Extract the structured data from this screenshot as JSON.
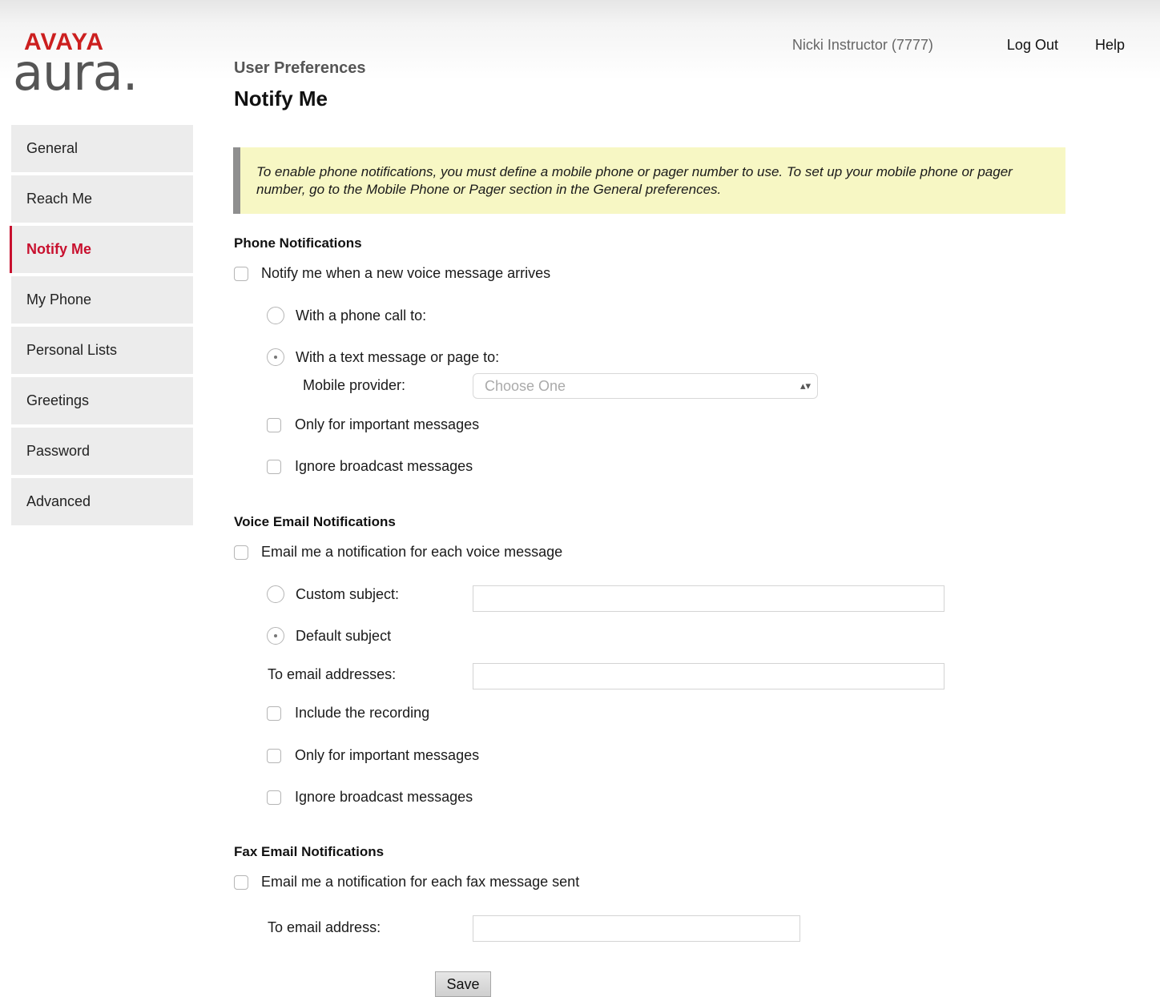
{
  "header": {
    "brand": "AVAYA",
    "product": "aura.",
    "user": "Nicki Instructor (7777)",
    "logout": "Log Out",
    "help": "Help"
  },
  "breadcrumb": "User Preferences",
  "page_title": "Notify Me",
  "sidebar": {
    "items": [
      {
        "label": "General"
      },
      {
        "label": "Reach Me"
      },
      {
        "label": "Notify Me",
        "active": true
      },
      {
        "label": "My Phone"
      },
      {
        "label": "Personal Lists"
      },
      {
        "label": "Greetings"
      },
      {
        "label": "Password"
      },
      {
        "label": "Advanced"
      }
    ]
  },
  "notice": "To enable phone notifications, you must define a mobile phone or pager number to use. To set up your mobile phone or pager number, go to the Mobile Phone or Pager section in the General preferences.",
  "phone": {
    "title": "Phone Notifications",
    "notify": {
      "label": "Notify me when a new voice message arrives",
      "checked": false
    },
    "phone_call": {
      "label": "With a phone call to:",
      "selected": false
    },
    "text_message": {
      "label": "With a text message or page to:",
      "selected": true
    },
    "mobile_provider": {
      "label": "Mobile provider:",
      "placeholder": "Choose One"
    },
    "important": {
      "label": "Only for important messages",
      "checked": false
    },
    "ignore_broadcast": {
      "label": "Ignore broadcast messages",
      "checked": false
    }
  },
  "voice_email": {
    "title": "Voice Email Notifications",
    "email_me": {
      "label": "Email me a notification for each voice message",
      "checked": false
    },
    "custom_subject": {
      "label": "Custom subject:",
      "selected": false,
      "value": ""
    },
    "default_subject": {
      "label": "Default subject",
      "selected": true
    },
    "to_emails": {
      "label": "To email addresses:",
      "value": ""
    },
    "include_recording": {
      "label": "Include the recording",
      "checked": false
    },
    "important": {
      "label": "Only for important messages",
      "checked": false
    },
    "ignore_broadcast": {
      "label": "Ignore broadcast messages",
      "checked": false
    }
  },
  "fax_email": {
    "title": "Fax Email Notifications",
    "email_me": {
      "label": "Email me a notification for each fax message sent",
      "checked": false
    },
    "to_email": {
      "label": "To email address:",
      "value": ""
    }
  },
  "save_label": "Save",
  "colors": {
    "brand_red": "#cc1f1f",
    "active_nav": "#c8102e",
    "notice_bg": "#f7f7c4",
    "notice_bar": "#8f8f8f",
    "sidebar_bg": "#ececec"
  }
}
